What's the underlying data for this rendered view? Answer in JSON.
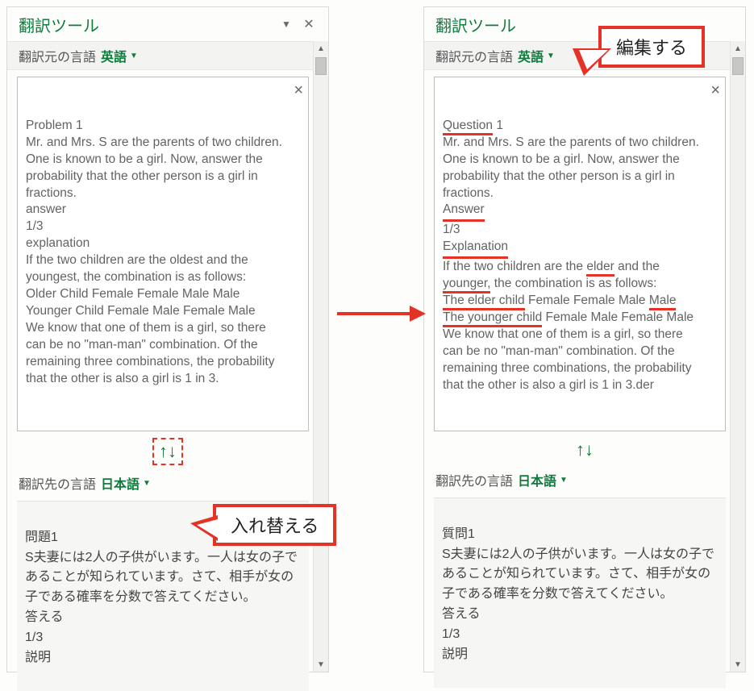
{
  "annotations": {
    "swap": "入れ替える",
    "edit": "編集する"
  },
  "pane_left": {
    "title": "翻訳ツール",
    "source": {
      "label": "翻訳元の言語",
      "lang": "英語",
      "lines": [
        "Problem 1",
        "Mr. and Mrs. S are the parents of two children. One is known to be a girl. Now, answer the probability that the other person is a girl in fractions.",
        "answer",
        "1/3",
        "explanation",
        "If the two children are the oldest and the youngest, the combination is as follows:",
        "Older Child Female Female Male Male",
        "Younger Child Female Male Female Male",
        "We know that one of them is a girl, so there can be no \"man-man\" combination. Of the remaining three combinations, the probability that the other is also a girl is 1 in 3."
      ]
    },
    "target": {
      "label": "翻訳先の言語",
      "lang": "日本語",
      "lines": [
        "問題1",
        "S夫妻には2人の子供がいます。一人は女の子であることが知られています。さて、相手が女の子である確率を分数で答えてください。",
        "答える",
        "1/3",
        "説明"
      ]
    }
  },
  "pane_right": {
    "title": "翻訳ツール",
    "source": {
      "label": "翻訳元の言語",
      "lang": "英語",
      "edited_terms": [
        "Question",
        "Answer",
        "Explanation",
        "elder",
        "younger,",
        "The elder child",
        "Male",
        "The younger child"
      ],
      "html_parts": {
        "l0a": "Question",
        "l0b": " 1",
        "l1": "Mr. and Mrs. S are the parents of two children. One is known to be a girl. Now, answer the probability that the other person is a girl in fractions.",
        "l2": "Answer",
        "l3": "1/3",
        "l4": "Explanation",
        "l5a": "If the two children are the ",
        "l5b": "elder",
        "l5c": " and the ",
        "l5d": "younger,",
        "l5e": " the combination is as follows:",
        "l6a": "The elder child",
        "l6b": " Female Female Male ",
        "l6c": "Male",
        "l7a": "The younger child",
        "l7b": " Female Male Female Male",
        "l8": "We know that one of them is a girl, so there can be no \"man-man\" combination. Of the remaining three combinations, the probability that the other is also a girl is 1 in 3.der"
      }
    },
    "target": {
      "label": "翻訳先の言語",
      "lang": "日本語",
      "lines": [
        "質問1",
        "S夫妻には2人の子供がいます。一人は女の子であることが知られています。さて、相手が女の子である確率を分数で答えてください。",
        "答える",
        "1/3",
        "説明"
      ]
    }
  }
}
